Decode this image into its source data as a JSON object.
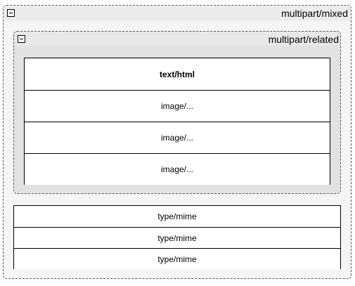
{
  "outer_container": {
    "label": "multipart/mixed",
    "collapse_icon": "minus-box-icon"
  },
  "inner_container": {
    "label": "multipart/related",
    "collapse_icon": "minus-box-icon",
    "parts": [
      {
        "label": "text/html",
        "bold": true
      },
      {
        "label": "image/...",
        "bold": false
      },
      {
        "label": "image/...",
        "bold": false
      },
      {
        "label": "image/...",
        "bold": false
      }
    ]
  },
  "mixed_parts": [
    {
      "label": "type/mime"
    },
    {
      "label": "type/mime"
    },
    {
      "label": "type/mime"
    }
  ]
}
